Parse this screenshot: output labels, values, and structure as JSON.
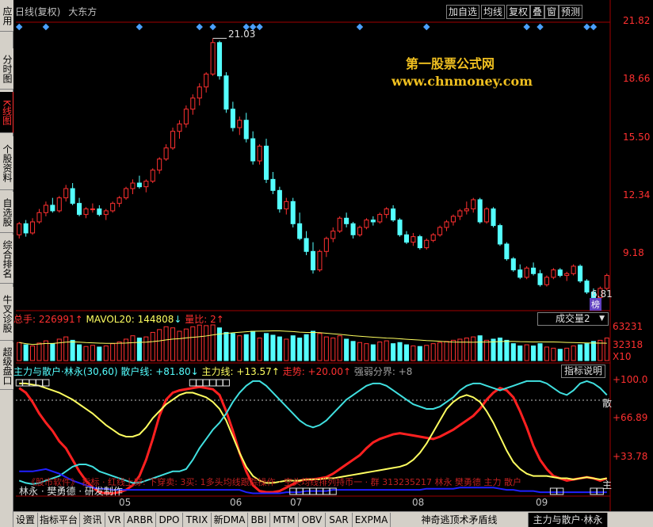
{
  "sidebar": {
    "items": [
      {
        "label": "应用",
        "active": false
      },
      {
        "label": "分时图",
        "active": false
      },
      {
        "label": "K线图",
        "active": true
      },
      {
        "label": "个股资料",
        "active": false
      },
      {
        "label": "自选股",
        "active": false
      },
      {
        "label": "综合排名",
        "active": false
      },
      {
        "label": "牛叉诊股",
        "active": false
      },
      {
        "label": "超级盘口",
        "active": false
      }
    ]
  },
  "header": {
    "period": "日线(复权)",
    "stock_name": "大东方"
  },
  "toolbar": {
    "buttons": [
      "加自选",
      "均线",
      "复权",
      "叠",
      "窗",
      "预测"
    ],
    "ranking_badge": "榜"
  },
  "watermark": {
    "line1": "第一股票公式网",
    "line2": "www.chnmoney.com"
  },
  "price_axis": {
    "labels": [
      "21.82",
      "18.66",
      "15.50",
      "12.34",
      "9.18"
    ]
  },
  "price_annotations": {
    "high": "21.03",
    "low": "6.81"
  },
  "volume_panel": {
    "total_label": "总手: ",
    "total_value": "226991",
    "mavol_label": "MAVOL20: ",
    "mavol_value": "144808",
    "ratio_label": "量比: ",
    "ratio_value": "2",
    "selector": "成交量2",
    "axis_labels": [
      "63231",
      "32318",
      "X10"
    ]
  },
  "indicator_panel": {
    "name": "主力与散户·林永(30,60)",
    "retail_label": "散户线: ",
    "retail_value": "+81.80",
    "main_label": "主力线: ",
    "main_value": "+13.57",
    "trend_label": "走势: ",
    "trend_value": "+20.00",
    "strong_label": "强弱分界: ",
    "strong_value": "+8",
    "explain_button": "指标说明",
    "axis_labels": [
      "+100.0",
      "+66.89",
      "+33.78"
    ],
    "right_markers": [
      "散",
      "主"
    ],
    "scroll_text": "《股市软件》 指标 · 红线上穿: 下穿卖: 3买: 1多头均线跟踪操作 · 空头均线排列持币一 · 群 313235217 林永 樊勇德 主力 散户",
    "author": "林永 · 樊勇德 · 研发制作"
  },
  "months": [
    "05",
    "06",
    "07",
    "08",
    "09"
  ],
  "bottom_tabs": [
    "设置",
    "指标平台",
    "资讯",
    "VR",
    "ARBR",
    "DPO",
    "TRIX",
    "新DMA",
    "BBI",
    "MTM",
    "OBV",
    "SAR",
    "EXPMA",
    "神奇逃顶术矛盾线",
    "主力与散户·林永"
  ],
  "colors": {
    "up": "#ff3030",
    "down": "#54ffff",
    "retail_line": "#ff2020",
    "main_line": "#ffff60",
    "trend_line": "#40e0e0",
    "blue_line": "#2020ff",
    "volume_ma": "#ffff60"
  },
  "chart_data": [
    {
      "type": "candlestick",
      "title": "大东方 日线(复权)",
      "ylim": [
        6.81,
        21.82
      ],
      "candles": [
        [
          10.4,
          11.1,
          10.2,
          11.0
        ],
        [
          11.0,
          11.2,
          10.3,
          10.5
        ],
        [
          10.5,
          11.3,
          10.4,
          11.1
        ],
        [
          11.1,
          11.8,
          11.0,
          11.6
        ],
        [
          11.6,
          12.2,
          11.4,
          12.0
        ],
        [
          12.0,
          12.4,
          11.6,
          11.7
        ],
        [
          11.7,
          12.5,
          11.6,
          12.4
        ],
        [
          12.4,
          13.1,
          12.2,
          12.9
        ],
        [
          12.9,
          13.2,
          12.0,
          12.1
        ],
        [
          12.1,
          12.4,
          11.4,
          11.5
        ],
        [
          11.5,
          11.9,
          11.3,
          11.8
        ],
        [
          11.8,
          12.1,
          11.6,
          11.8
        ],
        [
          11.8,
          12.0,
          11.4,
          11.5
        ],
        [
          11.5,
          11.8,
          11.2,
          11.7
        ],
        [
          11.7,
          12.2,
          11.6,
          12.1
        ],
        [
          12.1,
          12.5,
          11.9,
          12.4
        ],
        [
          12.4,
          13.0,
          12.3,
          12.9
        ],
        [
          12.9,
          13.4,
          12.6,
          13.2
        ],
        [
          13.2,
          13.6,
          12.9,
          13.0
        ],
        [
          13.0,
          13.4,
          12.7,
          13.3
        ],
        [
          13.3,
          14.0,
          13.2,
          13.9
        ],
        [
          13.9,
          14.6,
          13.7,
          14.5
        ],
        [
          14.5,
          15.3,
          14.4,
          15.1
        ],
        [
          15.1,
          16.2,
          15.0,
          16.0
        ],
        [
          16.0,
          16.6,
          15.6,
          16.4
        ],
        [
          16.4,
          17.4,
          16.2,
          17.2
        ],
        [
          17.2,
          18.0,
          16.9,
          17.8
        ],
        [
          17.8,
          18.6,
          17.4,
          18.4
        ],
        [
          18.4,
          19.2,
          18.1,
          19.1
        ],
        [
          19.1,
          21.03,
          19.0,
          20.8
        ],
        [
          20.8,
          20.9,
          18.8,
          19.0
        ],
        [
          19.0,
          19.2,
          17.0,
          17.2
        ],
        [
          17.2,
          17.6,
          16.0,
          16.2
        ],
        [
          16.2,
          16.8,
          15.8,
          16.6
        ],
        [
          16.6,
          17.0,
          15.4,
          15.6
        ],
        [
          15.6,
          16.0,
          14.2,
          14.4
        ],
        [
          14.4,
          15.3,
          14.2,
          15.2
        ],
        [
          15.2,
          15.6,
          13.2,
          13.4
        ],
        [
          13.4,
          13.8,
          12.6,
          12.8
        ],
        [
          12.8,
          13.0,
          11.6,
          11.8
        ],
        [
          11.8,
          12.4,
          11.5,
          12.2
        ],
        [
          12.2,
          12.4,
          10.8,
          11.0
        ],
        [
          11.0,
          11.6,
          10.1,
          10.2
        ],
        [
          10.2,
          10.6,
          9.3,
          9.5
        ],
        [
          9.5,
          10.0,
          8.3,
          8.5
        ],
        [
          8.5,
          9.6,
          8.4,
          9.5
        ],
        [
          9.5,
          10.3,
          9.2,
          10.2
        ],
        [
          10.2,
          10.8,
          10.0,
          10.6
        ],
        [
          10.6,
          11.4,
          10.5,
          11.3
        ],
        [
          11.3,
          11.6,
          10.8,
          11.0
        ],
        [
          11.0,
          11.1,
          10.2,
          10.4
        ],
        [
          10.4,
          10.9,
          10.3,
          10.8
        ],
        [
          10.8,
          11.3,
          10.7,
          11.2
        ],
        [
          11.2,
          11.4,
          10.9,
          11.1
        ],
        [
          11.1,
          11.6,
          11.0,
          11.5
        ],
        [
          11.5,
          11.9,
          11.3,
          11.8
        ],
        [
          11.8,
          12.0,
          11.1,
          11.2
        ],
        [
          11.2,
          11.3,
          10.3,
          10.4
        ],
        [
          10.4,
          10.6,
          9.9,
          10.0
        ],
        [
          10.0,
          10.5,
          9.8,
          10.3
        ],
        [
          10.3,
          10.4,
          9.6,
          9.7
        ],
        [
          9.7,
          10.2,
          9.6,
          10.1
        ],
        [
          10.1,
          10.5,
          10.0,
          10.4
        ],
        [
          10.4,
          10.9,
          10.3,
          10.8
        ],
        [
          10.8,
          11.2,
          10.6,
          11.1
        ],
        [
          11.1,
          11.5,
          10.9,
          11.4
        ],
        [
          11.4,
          11.8,
          11.2,
          11.7
        ],
        [
          11.7,
          12.2,
          11.5,
          11.8
        ],
        [
          11.8,
          12.4,
          11.6,
          12.3
        ],
        [
          12.3,
          12.4,
          11.0,
          11.1
        ],
        [
          11.1,
          11.9,
          11.0,
          11.8
        ],
        [
          11.8,
          11.9,
          10.8,
          10.9
        ],
        [
          10.9,
          11.0,
          9.8,
          9.9
        ],
        [
          9.9,
          10.0,
          9.0,
          9.1
        ],
        [
          9.1,
          9.2,
          8.4,
          8.5
        ],
        [
          8.5,
          8.8,
          8.0,
          8.1
        ],
        [
          8.1,
          8.7,
          8.0,
          8.6
        ],
        [
          8.6,
          8.9,
          8.2,
          8.3
        ],
        [
          8.3,
          8.5,
          7.6,
          7.7
        ],
        [
          7.7,
          8.2,
          7.6,
          8.1
        ],
        [
          8.1,
          8.6,
          8.0,
          8.5
        ],
        [
          8.5,
          8.6,
          8.1,
          8.2
        ],
        [
          8.2,
          8.4,
          7.9,
          8.3
        ],
        [
          8.3,
          8.8,
          8.2,
          8.7
        ],
        [
          8.7,
          8.8,
          7.8,
          7.9
        ],
        [
          7.9,
          8.0,
          7.2,
          7.3
        ],
        [
          7.3,
          7.5,
          6.81,
          7.0
        ],
        [
          7.0,
          7.6,
          6.9,
          7.5
        ],
        [
          7.5,
          8.3,
          7.4,
          8.2
        ]
      ]
    },
    {
      "type": "bar",
      "title": "成交量2",
      "ylim": [
        0,
        63231
      ],
      "values": [
        32000,
        28000,
        26000,
        31000,
        35000,
        30000,
        38000,
        42000,
        36000,
        28000,
        25000,
        27000,
        24000,
        26000,
        30000,
        33000,
        38000,
        44000,
        40000,
        42000,
        50000,
        55000,
        60000,
        58000,
        52000,
        56000,
        60000,
        63000,
        62000,
        63231,
        58000,
        50000,
        48000,
        44000,
        46000,
        52000,
        40000,
        48000,
        45000,
        42000,
        38000,
        44000,
        40000,
        46000,
        52000,
        48000,
        42000,
        40000,
        44000,
        38000,
        34000,
        32000,
        30000,
        28000,
        33000,
        35000,
        30000,
        32000,
        28000,
        26000,
        25000,
        27000,
        30000,
        32000,
        34000,
        36000,
        38000,
        40000,
        42000,
        44000,
        36000,
        38000,
        40000,
        36000,
        30000,
        26000,
        28000,
        26000,
        30000,
        24000,
        22000,
        20000,
        22000,
        26000,
        28000,
        30000,
        34000,
        36000,
        40000
      ]
    },
    {
      "type": "line",
      "title": "主力与散户·林永(30,60)",
      "ylim": [
        0,
        100
      ],
      "series": [
        {
          "name": "散户线",
          "values": [
            92,
            88,
            80,
            70,
            62,
            55,
            46,
            40,
            30,
            20,
            12,
            6,
            2,
            1,
            1,
            2,
            4,
            8,
            16,
            30,
            48,
            68,
            82,
            88,
            90,
            91,
            92,
            93,
            92,
            91,
            86,
            72,
            55,
            36,
            20,
            8,
            3,
            2,
            2,
            3,
            6,
            9,
            12,
            13,
            13,
            14,
            15,
            18,
            22,
            26,
            30,
            34,
            40,
            45,
            48,
            50,
            52,
            53,
            52,
            51,
            50,
            49,
            48,
            50,
            53,
            56,
            60,
            64,
            68,
            74,
            82,
            88,
            92,
            90,
            84,
            72,
            58,
            42,
            30,
            22,
            16,
            14,
            12,
            13,
            14,
            15,
            14,
            12,
            14
          ]
        },
        {
          "name": "主力线",
          "values": [
            96,
            96,
            95,
            94,
            92,
            90,
            88,
            85,
            82,
            78,
            74,
            70,
            65,
            60,
            56,
            52,
            50,
            50,
            52,
            58,
            66,
            72,
            78,
            82,
            86,
            88,
            88,
            86,
            84,
            80,
            74,
            64,
            50,
            36,
            24,
            16,
            12,
            10,
            10,
            11,
            12,
            12,
            12,
            13,
            13,
            13,
            14,
            14,
            15,
            16,
            17,
            18,
            19,
            20,
            21,
            22,
            23,
            24,
            26,
            30,
            36,
            44,
            54,
            64,
            74,
            80,
            84,
            86,
            84,
            80,
            72,
            62,
            50,
            38,
            28,
            22,
            18,
            16,
            16,
            16,
            15,
            14,
            14,
            13,
            14,
            15,
            14,
            13,
            14
          ]
        },
        {
          "name": "走势",
          "values": [
            12,
            10,
            9,
            10,
            12,
            14,
            16,
            20,
            24,
            26,
            26,
            24,
            20,
            18,
            16,
            14,
            12,
            10,
            10,
            12,
            14,
            16,
            18,
            20,
            20,
            22,
            30,
            40,
            48,
            56,
            62,
            70,
            80,
            88,
            94,
            98,
            98,
            94,
            88,
            82,
            76,
            70,
            64,
            60,
            58,
            60,
            64,
            70,
            76,
            82,
            86,
            90,
            94,
            96,
            96,
            94,
            90,
            86,
            82,
            78,
            76,
            74,
            74,
            76,
            80,
            84,
            90,
            94,
            96,
            96,
            94,
            92,
            90,
            92,
            94,
            96,
            98,
            98,
            98,
            96,
            92,
            88,
            86,
            90,
            96,
            98,
            96,
            92,
            86
          ]
        },
        {
          "name": "强弱分界",
          "values": [
            20,
            20,
            20,
            21,
            22,
            20,
            18,
            15,
            12,
            10,
            8,
            6,
            5,
            5,
            4,
            4,
            4,
            4,
            4,
            4,
            4,
            4,
            4,
            4,
            4,
            4,
            4,
            4,
            4,
            4,
            4,
            4,
            4,
            4,
            2,
            1,
            1,
            1,
            1,
            1,
            2,
            2,
            2,
            3,
            3,
            3,
            3,
            4,
            4,
            4,
            4,
            4,
            4,
            4,
            4,
            4,
            4,
            4,
            4,
            4,
            4,
            5,
            5,
            5,
            5,
            5,
            6,
            6,
            6,
            6,
            6,
            6,
            5,
            4,
            4,
            3,
            3,
            3,
            2,
            2,
            2,
            2,
            2,
            2,
            2,
            2,
            2,
            2,
            2
          ]
        }
      ]
    }
  ]
}
